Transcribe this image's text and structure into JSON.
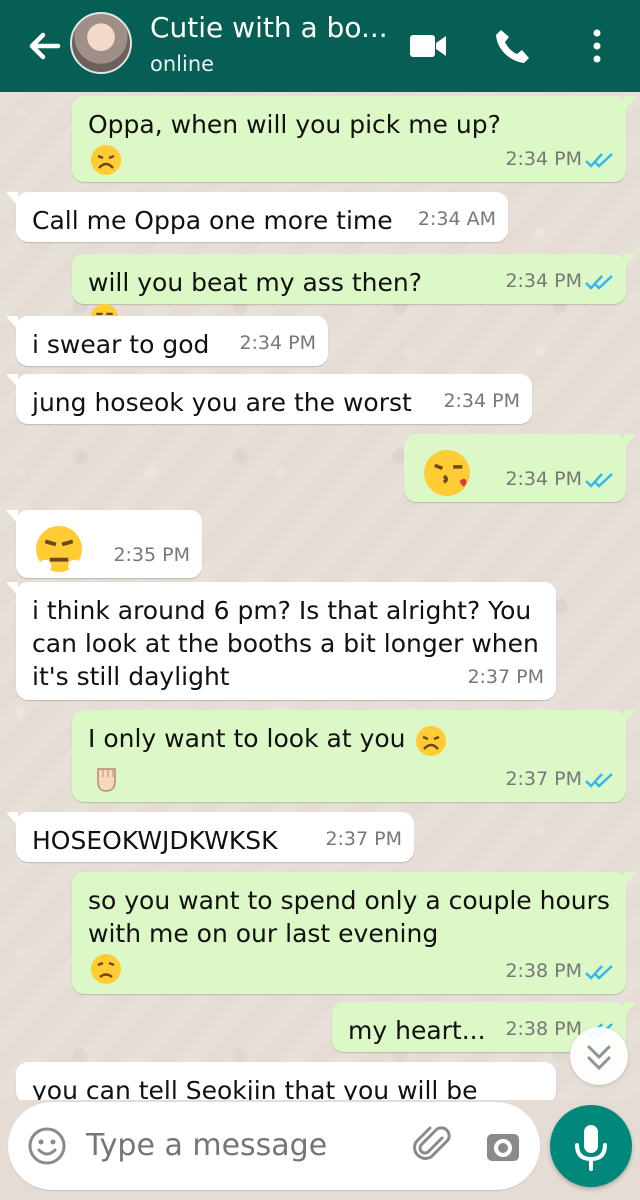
{
  "header": {
    "title": "Cutie with a bo...",
    "status": "online",
    "icons": [
      "back-arrow-icon",
      "video-call-icon",
      "phone-icon",
      "more-options-icon"
    ],
    "color": "#075e54"
  },
  "messages": [
    {
      "direction": "outgoing",
      "text": "Oppa, when will you pick me up?",
      "emoji": "tired-face",
      "time": "2:34 PM",
      "status": "read"
    },
    {
      "direction": "incoming",
      "text": "Call me Oppa one more time",
      "time": "2:34 AM"
    },
    {
      "direction": "outgoing",
      "text": "will you beat my ass then?",
      "emoji": "smirking-face",
      "time": "2:34 PM",
      "status": "read"
    },
    {
      "direction": "incoming",
      "text": "i swear to god",
      "time": "2:34 PM"
    },
    {
      "direction": "incoming",
      "text": "jung hoseok you are the worst",
      "time": "2:34 PM"
    },
    {
      "direction": "outgoing",
      "emoji": "face-blowing-kiss",
      "time": "2:34 PM",
      "status": "read"
    },
    {
      "direction": "incoming",
      "emoji": "steam-from-nose",
      "time": "2:35 PM"
    },
    {
      "direction": "incoming",
      "text": "i think around 6 pm? Is that alright? You can look at the booths a bit longer when it's still daylight",
      "time": "2:37 PM"
    },
    {
      "direction": "outgoing",
      "text": "I only want to look at you",
      "emoji": "tired-face, raised-fist",
      "time": "2:37 PM",
      "status": "read"
    },
    {
      "direction": "incoming",
      "text": "HOSEOKWJDKWKSK",
      "time": "2:37 PM"
    },
    {
      "direction": "outgoing",
      "text": "so you want to spend only a couple hours with me on our last evening",
      "emoji": "disappointed-face",
      "time": "2:38 PM",
      "status": "read"
    },
    {
      "direction": "outgoing",
      "text": "my heart...",
      "time": "2:38 PM",
      "status": "read"
    },
    {
      "direction": "incoming",
      "text": "you can tell Seokjin that you will be"
    }
  ],
  "composer": {
    "placeholder": "Type a message",
    "icons": [
      "emoji-icon",
      "attachment-icon",
      "camera-icon",
      "microphone-icon"
    ],
    "accent": "#00897b"
  },
  "colors": {
    "incoming": "#ffffff",
    "outgoing": "#dcf8c6",
    "read_ticks": "#34b7f1"
  }
}
